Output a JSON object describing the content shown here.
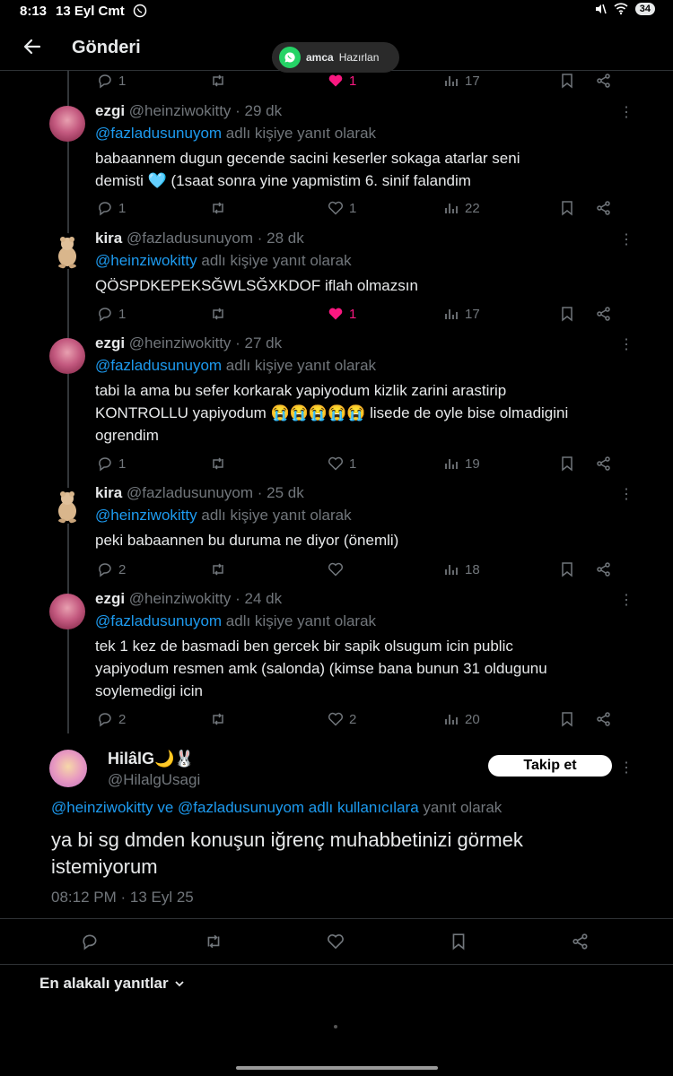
{
  "status_bar": {
    "time": "8:13",
    "date": "13 Eyl Cmt",
    "battery": "34"
  },
  "header": {
    "title": "Gönderi"
  },
  "toast": {
    "name": "amca",
    "status": "Hazırlan"
  },
  "top_actions": {
    "replies": "1",
    "likes": "1",
    "views": "17"
  },
  "replies": [
    {
      "name": "ezgi",
      "handle": "@heinziwokitty",
      "time": "29 dk",
      "reply_to": "@fazladusunuyom",
      "reply_suffix": "adlı kişiye yanıt olarak",
      "text_1": "babaannem dugun gecende sacini keserler sokaga atarlar seni",
      "text_2": "demisti 🩵 (1saat sonra yine yapmistim 6. sinif falandim",
      "replies": "1",
      "likes": "1",
      "views": "22"
    },
    {
      "name": "kira",
      "handle": "@fazladusunuyom",
      "time": "28 dk",
      "reply_to": "@heinziwokitty",
      "reply_suffix": "adlı kişiye yanıt olarak",
      "text_1": "QÖSPDKEPEKSĞWLSĞXKDOF iflah olmazsın",
      "replies": "1",
      "likes": "1",
      "views": "17"
    },
    {
      "name": "ezgi",
      "handle": "@heinziwokitty",
      "time": "27 dk",
      "reply_to": "@fazladusunuyom",
      "reply_suffix": "adlı kişiye yanıt olarak",
      "text_1": "tabi la ama bu sefer korkarak yapiyodum kizlik zarini arastirip",
      "text_2": "KONTROLLU yapiyodum 😭😭😭😭😭 lisede de oyle bise olmadigini",
      "text_3": "ogrendim",
      "replies": "1",
      "likes": "1",
      "views": "19"
    },
    {
      "name": "kira",
      "handle": "@fazladusunuyom",
      "time": "25 dk",
      "reply_to": "@heinziwokitty",
      "reply_suffix": "adlı kişiye yanıt olarak",
      "text_1": "peki babaannen bu duruma ne diyor (önemli)",
      "replies": "2",
      "likes": "",
      "views": "18"
    },
    {
      "name": "ezgi",
      "handle": "@heinziwokitty",
      "time": "24 dk",
      "reply_to": "@fazladusunuyom",
      "reply_suffix": "adlı kişiye yanıt olarak",
      "text_1": "tek 1 kez de basmadi ben gercek bir sapik olsugum icin public",
      "text_2": "yapiyodum resmen amk (salonda) (kimse bana bunun 31 oldugunu",
      "text_3": "soylemedigi icin",
      "replies": "2",
      "likes": "2",
      "views": "20"
    }
  ],
  "main_post": {
    "name": "HilâlG🌙🐰",
    "handle": "@HilalgUsagi",
    "follow_label": "Takip et",
    "reply_to_mentions": "@heinziwokitty ve @fazladusunuyom adlı kullanıcılara",
    "reply_to_suffix": "yanıt olarak",
    "text_1": "ya bi sg dmden konuşun iğrenç muhabbetinizi görmek",
    "text_2": "istemiyorum",
    "timestamp": "08:12 PM · 13 Eyl 25"
  },
  "sort_label": "En alakalı yanıtlar",
  "colors": {
    "accent": "#1d9bf0",
    "like": "#f91880",
    "muted": "#71767b",
    "background": "#000000"
  },
  "icons": [
    "back-arrow-icon",
    "whatsapp-icon",
    "reply-icon",
    "retweet-icon",
    "heart-icon",
    "views-icon",
    "bookmark-icon",
    "share-icon",
    "more-icon",
    "chevron-down-icon"
  ]
}
